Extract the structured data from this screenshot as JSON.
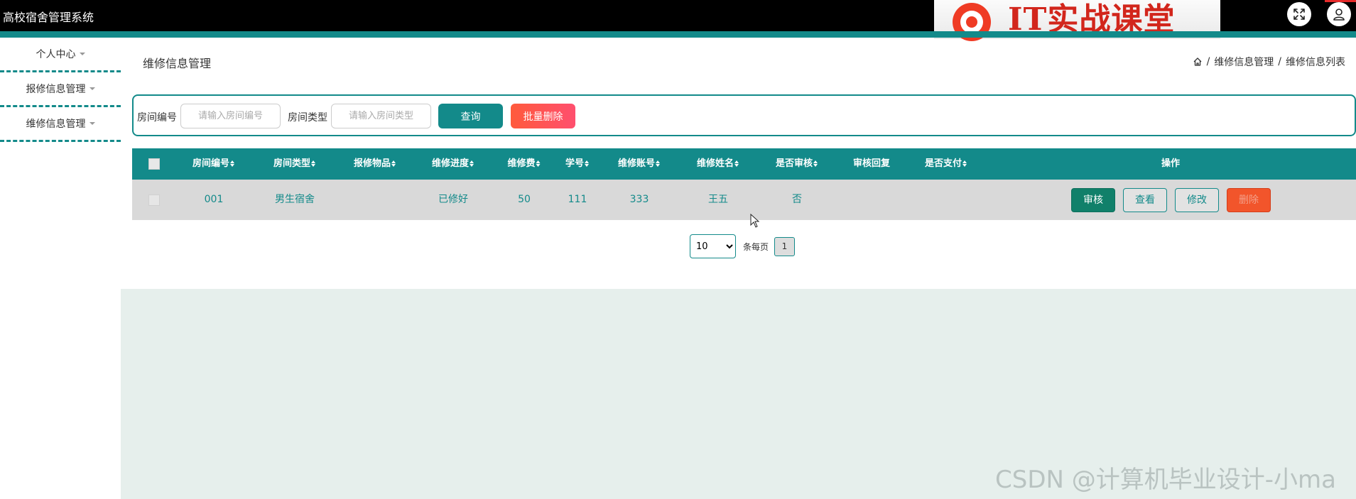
{
  "app": {
    "title": "高校宿舍管理系统",
    "logo_text": "IT实战课堂"
  },
  "header_icons": [
    "fullscreen-icon",
    "user-icon"
  ],
  "sidebar": {
    "items": [
      {
        "label": "个人中心"
      },
      {
        "label": "报修信息管理"
      },
      {
        "label": "维修信息管理"
      }
    ]
  },
  "page": {
    "title": "维修信息管理",
    "breadcrumb": [
      "维修信息管理",
      "维修信息列表"
    ],
    "separator": "/"
  },
  "search": {
    "room_no_label": "房间编号",
    "room_no_placeholder": "请输入房间编号",
    "room_no_value": "",
    "room_type_label": "房间类型",
    "room_type_placeholder": "请输入房间类型",
    "room_type_value": "",
    "query_button": "查询",
    "batch_delete_button": "批量删除"
  },
  "table": {
    "columns": [
      "房间编号",
      "房间类型",
      "报修物品",
      "维修进度",
      "维修费",
      "学号",
      "维修账号",
      "维修姓名",
      "是否审核",
      "审核回复",
      "是否支付",
      "操作"
    ],
    "sortable": [
      true,
      true,
      true,
      true,
      true,
      true,
      true,
      true,
      true,
      false,
      true,
      false
    ],
    "rows": [
      {
        "cells": [
          "001",
          "男生宿舍",
          "",
          "已修好",
          "50",
          "111",
          "333",
          "王五",
          "否",
          "",
          ""
        ],
        "actions": [
          "审核",
          "查看",
          "修改",
          "删除"
        ]
      }
    ]
  },
  "pager": {
    "page_size": "10",
    "page_size_options": [
      "10"
    ],
    "per_page_label": "条每页",
    "current_page": "1"
  },
  "watermark": "CSDN @计算机毕业设计-小ma",
  "colors": {
    "primary": "#138a8a",
    "danger": "#f2552b",
    "audit": "#11806a",
    "content_bg": "#e6efec"
  }
}
